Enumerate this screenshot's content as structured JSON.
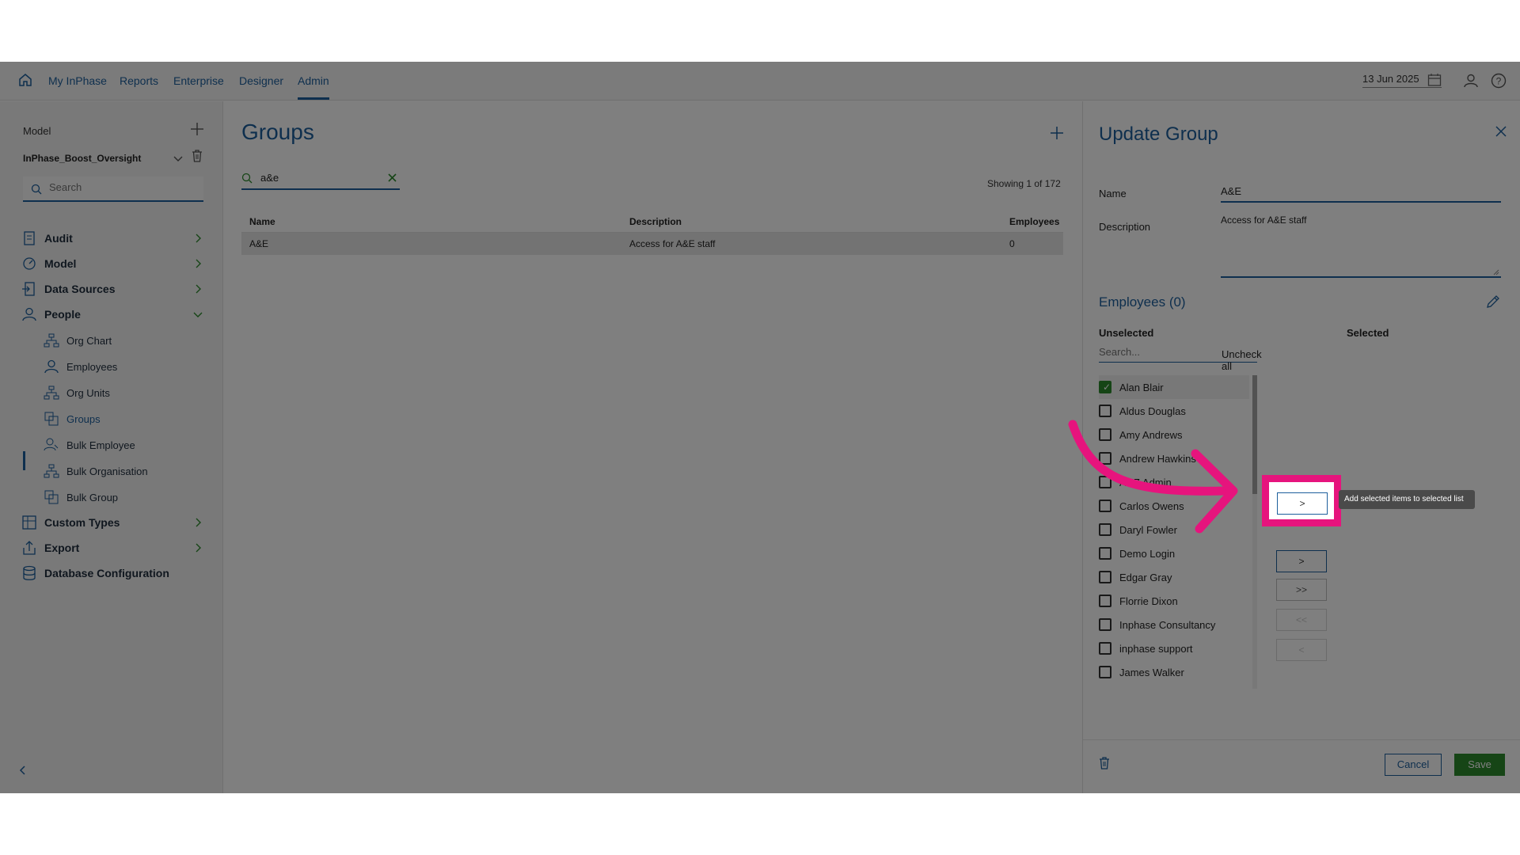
{
  "topnav": {
    "items": [
      "My InPhase",
      "Reports",
      "Enterprise",
      "Designer",
      "Admin"
    ],
    "active": "Admin",
    "date": "13 Jun 2025"
  },
  "sidebar": {
    "model_label": "Model",
    "model_name": "InPhase_Boost_Oversight",
    "search_placeholder": "Search",
    "items": [
      {
        "label": "Audit",
        "icon": "audit-icon"
      },
      {
        "label": "Model",
        "icon": "model-icon"
      },
      {
        "label": "Data Sources",
        "icon": "data-sources-icon"
      },
      {
        "label": "People",
        "icon": "people-icon",
        "expanded": true
      },
      {
        "label": "Custom Types",
        "icon": "custom-types-icon"
      },
      {
        "label": "Export",
        "icon": "export-icon"
      },
      {
        "label": "Database Configuration",
        "icon": "database-icon"
      }
    ],
    "people_sub": [
      {
        "label": "Org Chart",
        "icon": "org-chart-icon"
      },
      {
        "label": "Employees",
        "icon": "employee-icon"
      },
      {
        "label": "Org Units",
        "icon": "org-units-icon"
      },
      {
        "label": "Groups",
        "icon": "groups-icon",
        "active": true
      },
      {
        "label": "Bulk Employee",
        "icon": "bulk-employee-icon"
      },
      {
        "label": "Bulk Organisation",
        "icon": "bulk-organisation-icon"
      },
      {
        "label": "Bulk Group",
        "icon": "bulk-group-icon"
      }
    ]
  },
  "groups": {
    "title": "Groups",
    "search_value": "a&e",
    "showing": "Showing 1 of 172",
    "columns": [
      "Name",
      "Description",
      "Employees"
    ],
    "rows": [
      [
        "A&E",
        "Access for A&E staff",
        "0"
      ]
    ]
  },
  "panel": {
    "title": "Update Group",
    "name_label": "Name",
    "name_value": "A&E",
    "description_label": "Description",
    "description_value": "Access for A&E staff",
    "employees_title": "Employees (0)",
    "unselected_label": "Unselected",
    "selected_label": "Selected",
    "search_placeholder": "Search...",
    "uncheck_all": "Uncheck all",
    "employees": [
      {
        "name": "Alan Blair",
        "checked": true
      },
      {
        "name": "Aldus Douglas",
        "checked": false
      },
      {
        "name": "Amy Andrews",
        "checked": false
      },
      {
        "name": "Andrew Hawkins",
        "checked": false
      },
      {
        "name": "ANZ Admin",
        "checked": false
      },
      {
        "name": "Carlos Owens",
        "checked": false
      },
      {
        "name": "Daryl Fowler",
        "checked": false
      },
      {
        "name": "Demo Login",
        "checked": false
      },
      {
        "name": "Edgar Gray",
        "checked": false
      },
      {
        "name": "Florrie Dixon",
        "checked": false
      },
      {
        "name": "Inphase Consultancy",
        "checked": false
      },
      {
        "name": "inphase support",
        "checked": false
      },
      {
        "name": "James Walker",
        "checked": false
      }
    ],
    "transfer_buttons": [
      ">",
      ">>",
      "<<",
      "<"
    ],
    "tooltip": "Add selected items to selected list",
    "cancel": "Cancel",
    "save": "Save"
  },
  "colors": {
    "accent": "#1d5f9c",
    "save": "#2d8a2d",
    "highlight": "#e6147d"
  }
}
